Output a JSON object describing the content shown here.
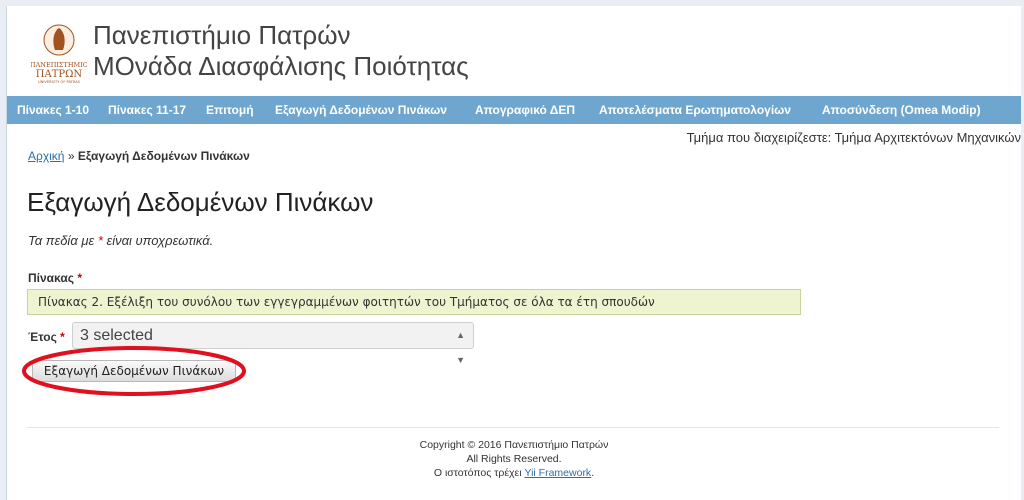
{
  "header": {
    "title_line1": "Πανεπιστήμιο Πατρών",
    "title_line2": "ΜΟνάδα Διασφάλισης Ποιότητας",
    "logo": {
      "icon": "university-seal-icon",
      "text_top": "ΠΑΝΕΠΙΣΤΗΜΙΟ",
      "text_main": "ΠΑΤΡΩΝ",
      "text_bottom": "UNIVERSITY OF PATRAS",
      "color": "#a0521f"
    }
  },
  "menu": {
    "items": [
      "Πίνακες 1-10",
      "Πίνακες 11-17",
      "Επιτομή",
      "Εξαγωγή Δεδομένων Πινάκων",
      "Απογραφικό ΔΕΠ",
      "Αποτελέσματα Ερωτηματολογίων",
      "Αποσύνδεση (Omea Modip)"
    ],
    "color": "#6fa6cf"
  },
  "department_text": "Τμήμα που διαχειρίζεστε: Τμήμα Αρχιτεκτόνων Μηχανικών",
  "breadcrumb": {
    "home": "Αρχική",
    "separator": "»",
    "current": "Εξαγωγή Δεδομένων Πινάκων"
  },
  "page_title": "Εξαγωγή Δεδομένων Πινάκων",
  "required_note": {
    "before": "Τα πεδία με",
    "star": "*",
    "after": "είναι υποχρεωτικά."
  },
  "form": {
    "table_label": "Πίνακας",
    "table_value": "Πίνακας 2. Εξέλιξη του συνόλου των εγγεγραμμένων φοιτητών του Τμήματος σε όλα τα έτη σπουδών",
    "year_label": "Έτος",
    "year_value": "3 selected",
    "year_arrows_icon": "select-arrows-icon",
    "required_star": "*",
    "submit_label": "Εξαγωγή Δεδομένων Πινάκων"
  },
  "annotation": {
    "shape": "red-oval-highlight",
    "color": "#e0101e"
  },
  "footer": {
    "copyright": "Copyright © 2016 Πανεπιστήμιο Πατρών",
    "rights": "All Rights Reserved.",
    "powered_prefix": "Ο ιστοτόπος τρέχει",
    "powered_link": "Yii Framework",
    "powered_suffix": "."
  }
}
